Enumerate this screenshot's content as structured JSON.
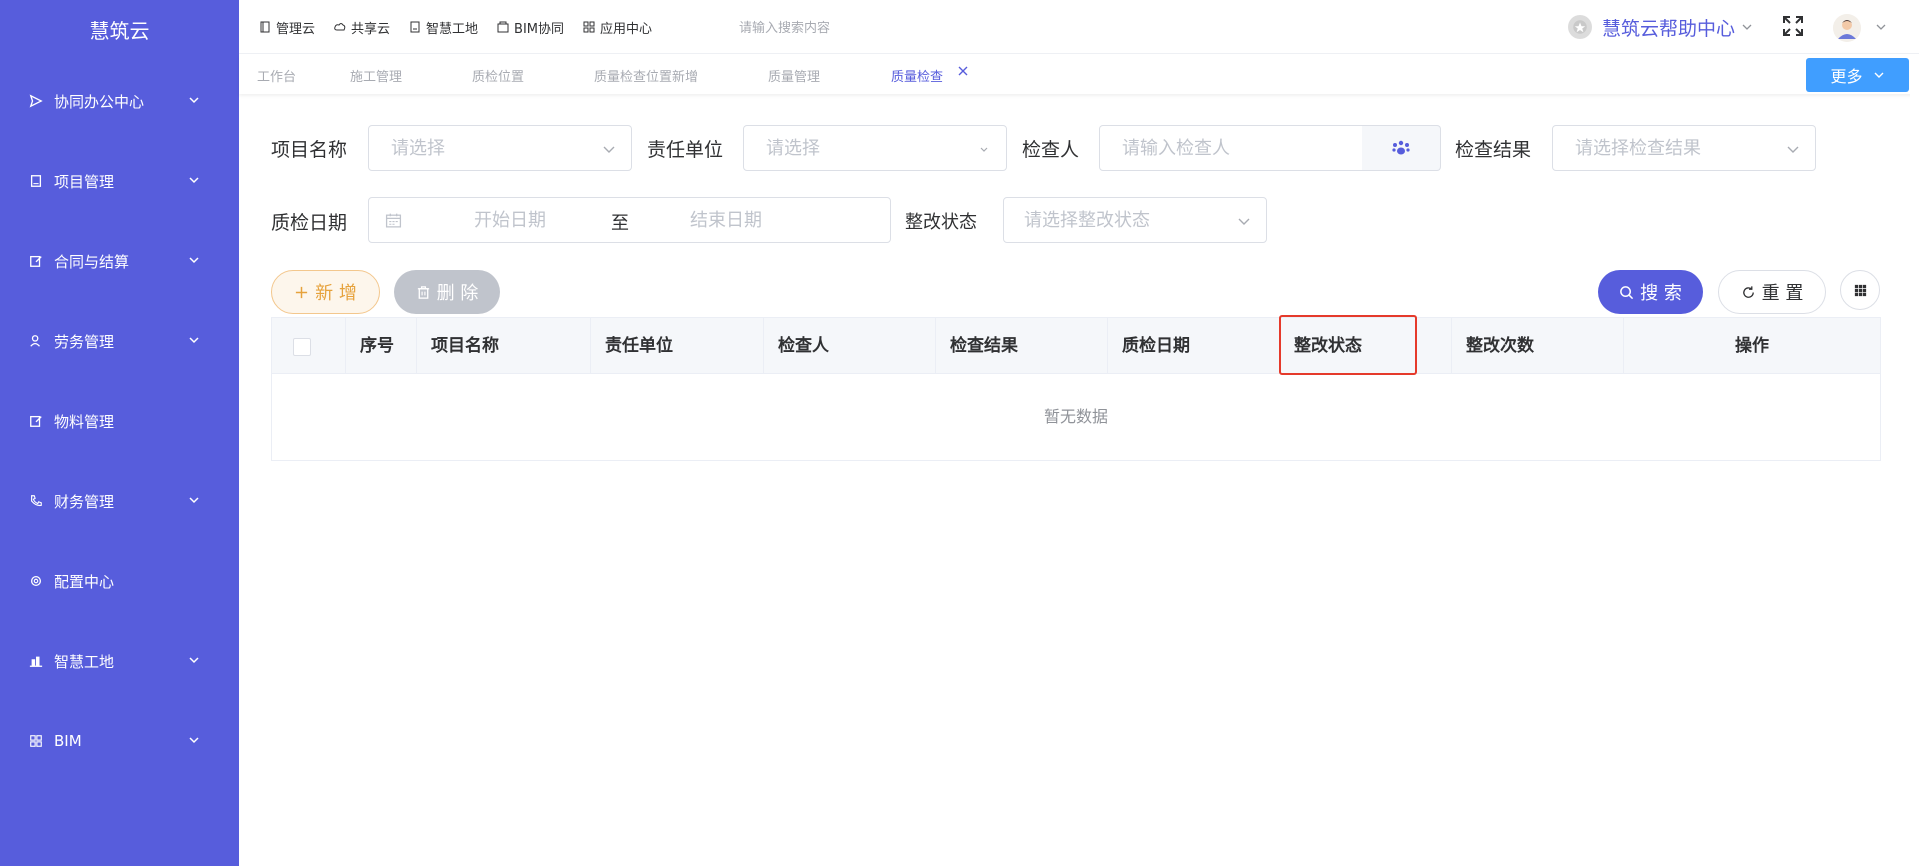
{
  "app": {
    "logo": "慧筑云"
  },
  "sidebar": {
    "items": [
      {
        "label": "协同办公中心",
        "icon": "send-icon",
        "has_children": true
      },
      {
        "label": "项目管理",
        "icon": "book-icon",
        "has_children": true
      },
      {
        "label": "合同与结算",
        "icon": "edit-doc-icon",
        "has_children": true
      },
      {
        "label": "劳务管理",
        "icon": "worker-icon",
        "has_children": true
      },
      {
        "label": "物料管理",
        "icon": "edit-doc-icon",
        "has_children": false
      },
      {
        "label": "财务管理",
        "icon": "phone-icon",
        "has_children": true
      },
      {
        "label": "配置中心",
        "icon": "gear-icon",
        "has_children": false
      },
      {
        "label": "智慧工地",
        "icon": "building-icon",
        "has_children": true
      },
      {
        "label": "BIM",
        "icon": "grid-icon",
        "has_children": true
      }
    ]
  },
  "topnav": {
    "items": [
      {
        "label": "管理云",
        "icon": "doc-icon"
      },
      {
        "label": "共享云",
        "icon": "cloud-icon"
      },
      {
        "label": "智慧工地",
        "icon": "book-icon"
      },
      {
        "label": "BIM协同",
        "icon": "box-icon"
      },
      {
        "label": "应用中心",
        "icon": "grid-icon"
      }
    ],
    "search_placeholder": "请输入搜索内容",
    "help_label": "慧筑云帮助中心"
  },
  "tabs": {
    "items": [
      {
        "label": "工作台",
        "active": false
      },
      {
        "label": "施工管理",
        "active": false
      },
      {
        "label": "质检位置",
        "active": false
      },
      {
        "label": "质量检查位置新增",
        "active": false
      },
      {
        "label": "质量管理",
        "active": false
      },
      {
        "label": "质量检查",
        "active": true
      }
    ],
    "more_label": "更多"
  },
  "filters": {
    "project_label": "项目名称",
    "project_placeholder": "请选择",
    "unit_label": "责任单位",
    "unit_placeholder": "请选择",
    "inspector_label": "检查人",
    "inspector_placeholder": "请输入检查人",
    "result_label": "检查结果",
    "result_placeholder": "请选择检查结果",
    "date_label": "质检日期",
    "date_start_placeholder": "开始日期",
    "date_separator": "至",
    "date_end_placeholder": "结束日期",
    "rectify_label": "整改状态",
    "rectify_placeholder": "请选择整改状态"
  },
  "actions": {
    "add_label": "新 增",
    "delete_label": "删 除",
    "search_label": "搜 索",
    "reset_label": "重 置"
  },
  "table": {
    "columns": [
      "序号",
      "项目名称",
      "责任单位",
      "检查人",
      "检查结果",
      "质检日期",
      "整改状态",
      "整改次数",
      "操作"
    ],
    "empty_text": "暂无数据"
  },
  "colors": {
    "sidebar_bg": "#575ddc",
    "primary": "#575ddc",
    "more_button": "#409eff",
    "add_button_text": "#e6a23c",
    "highlight_border": "#e53a2b"
  }
}
